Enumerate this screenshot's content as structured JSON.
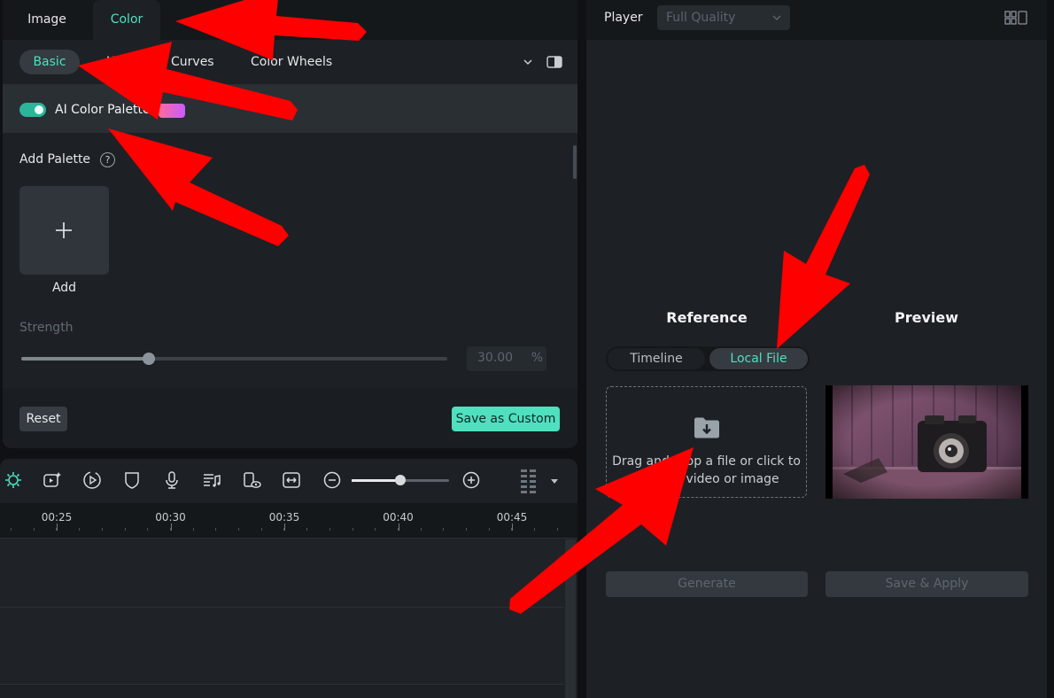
{
  "left_panel": {
    "tabs": {
      "image": "Image",
      "color": "Color"
    },
    "sub_tabs": {
      "basic": "Basic",
      "hsl": "HSL",
      "curves": "Curves",
      "color_wheels": "Color Wheels"
    },
    "ai_color_palette": {
      "label": "AI Color Palette",
      "enabled": true
    },
    "add_palette": {
      "label": "Add Palette",
      "help": "?",
      "add_label": "Add"
    },
    "strength": {
      "label": "Strength",
      "value": "30.00",
      "unit": "%",
      "fraction": 0.3
    },
    "buttons": {
      "reset": "Reset",
      "save_as_custom": "Save as Custom"
    }
  },
  "timeline": {
    "ticks": [
      "00:25",
      "00:30",
      "00:35",
      "00:40",
      "00:45"
    ],
    "zoom_fraction": 0.5
  },
  "right_panel": {
    "player": {
      "label": "Player",
      "quality": "Full Quality"
    },
    "reference": {
      "title": "Reference",
      "tabs": {
        "timeline": "Timeline",
        "local_file": "Local File"
      },
      "drop_line1": "Drag and drop a file or click to",
      "drop_line2": "select a video or image"
    },
    "preview": {
      "title": "Preview"
    },
    "buttons": {
      "generate": "Generate",
      "save_apply": "Save & Apply"
    }
  },
  "colors": {
    "accent": "#4fe0c0",
    "panel": "#1d2125",
    "annotation": "#ff0000"
  }
}
